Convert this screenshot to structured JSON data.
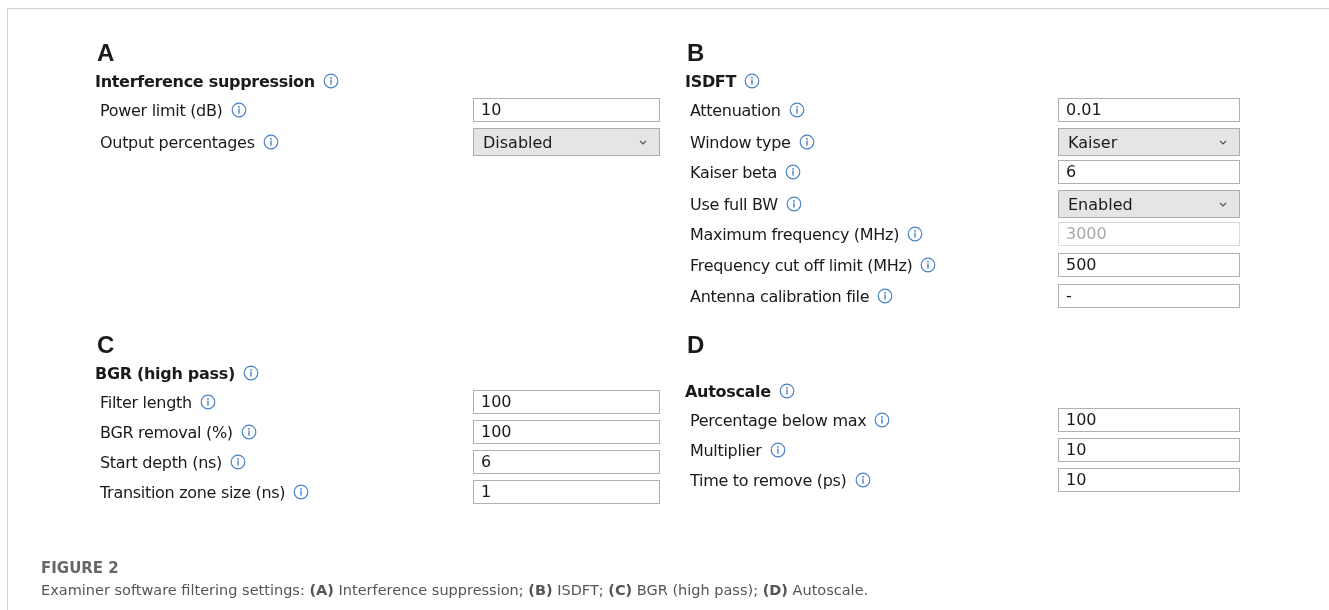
{
  "panels": [
    {
      "letter": "A",
      "title": "Interference suppression",
      "rows": [
        {
          "label": "Power limit (dB)",
          "kind": "text",
          "value": "10"
        },
        {
          "label": "Output percentages",
          "kind": "dropdown",
          "value": "Disabled"
        }
      ]
    },
    {
      "letter": "B",
      "title": "ISDFT",
      "rows": [
        {
          "label": "Attenuation",
          "kind": "text",
          "value": "0.01",
          "disabled": false
        },
        {
          "label": "Window type",
          "kind": "dropdown",
          "value": "Kaiser",
          "disabled": false
        },
        {
          "label": "Kaiser beta",
          "kind": "text",
          "value": "6",
          "disabled": false
        },
        {
          "label": "Use full BW",
          "kind": "dropdown",
          "value": "Enabled",
          "disabled": false
        },
        {
          "label": "Maximum frequency (MHz)",
          "kind": "text",
          "value": "3000",
          "disabled": true
        },
        {
          "label": "Frequency cut off limit (MHz)",
          "kind": "text",
          "value": "500",
          "disabled": false
        },
        {
          "label": "Antenna calibration file",
          "kind": "text",
          "value": "-",
          "disabled": false
        }
      ]
    },
    {
      "letter": "C",
      "title": "BGR (high pass)",
      "rows": [
        {
          "label": "Filter length",
          "kind": "text",
          "value": "100"
        },
        {
          "label": "BGR removal (%)",
          "kind": "text",
          "value": "100"
        },
        {
          "label": "Start depth (ns)",
          "kind": "text",
          "value": "6"
        },
        {
          "label": "Transition zone size (ns)",
          "kind": "text",
          "value": "1"
        }
      ]
    },
    {
      "letter": "D",
      "title": "Autoscale",
      "rows": [
        {
          "label": "Percentage below max",
          "kind": "text",
          "value": "100"
        },
        {
          "label": "Multiplier",
          "kind": "text",
          "value": "10"
        },
        {
          "label": "Time to remove (ps)",
          "kind": "text",
          "value": "10"
        }
      ]
    }
  ],
  "caption": {
    "heading": "FIGURE 2",
    "text": "Examiner software filtering settings: **(A)** Interference suppression; **(B)** ISDFT; **(C)** BGR (high pass); **(D)** Autoscale."
  }
}
